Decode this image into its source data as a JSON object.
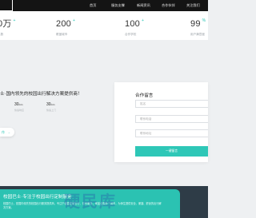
{
  "nav": {
    "items": [
      "首页",
      "服务支撑",
      "新闻资讯",
      "合作伙伴",
      "关注我们"
    ]
  },
  "stats": [
    {
      "value": "0万",
      "plus": "+",
      "label": "人数"
    },
    {
      "value": "200",
      "plus": "+",
      "label": "覆盖城市"
    },
    {
      "value": "100",
      "plus": "+",
      "label": "合作学校"
    },
    {
      "value": "99",
      "plus": "%",
      "label": "用户满意度"
    }
  ],
  "intro": {
    "title": "士·国内领先的校园出行解决方案提供商！",
    "metrics": [
      {
        "value": "30",
        "unit": "min",
        "label": "快速响应"
      },
      {
        "value": "30",
        "unit": "min",
        "label": "快速上门"
      }
    ],
    "button_label": "作",
    "button_arrow": "→"
  },
  "form": {
    "title": "合作留言",
    "fields": [
      {
        "placeholder": "姓名"
      },
      {
        "placeholder": "联系电话"
      },
      {
        "placeholder": "联系地址"
      }
    ],
    "submit_label": "一键留言"
  },
  "banner": {
    "title": "校园巴士·专注于校园出行定制服务",
    "text": "校园巴士，是国内领先的校园出行服务提供商，专注于校园定制出行、包车服务，覆盖全国多个城市，为师生提供安全、便捷、舒适的出行解决方案。"
  },
  "watermark": "硬民库"
}
